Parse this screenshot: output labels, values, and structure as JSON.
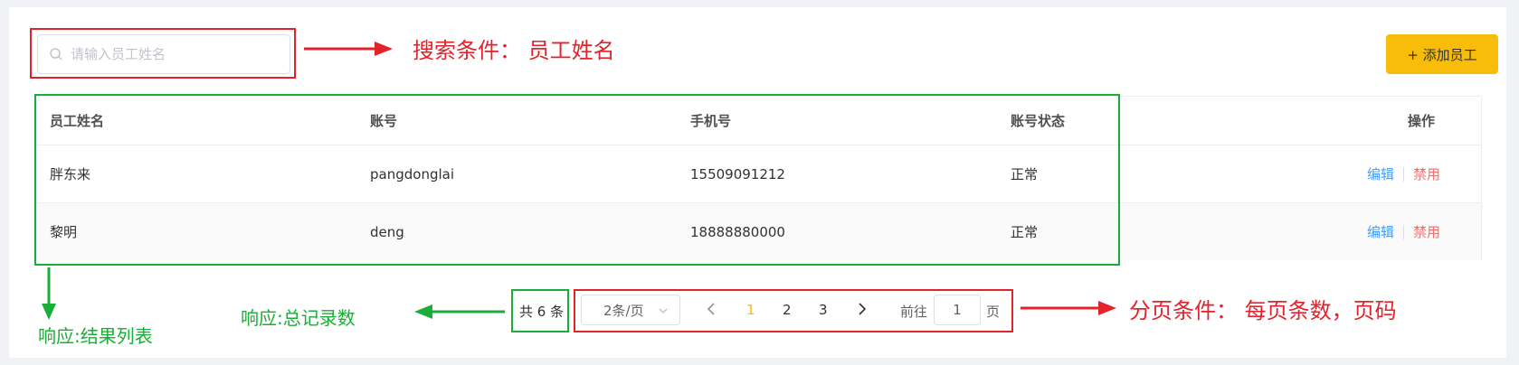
{
  "search": {
    "placeholder": "请输入员工姓名"
  },
  "toolbar": {
    "add_label": "+ 添加员工"
  },
  "annotations": {
    "search_condition": "搜索条件： 员工姓名",
    "result_list": "响应:结果列表",
    "total_records": "响应:总记录数",
    "page_condition": "分页条件： 每页条数，页码"
  },
  "table": {
    "columns": [
      "员工姓名",
      "账号",
      "手机号",
      "账号状态",
      "操作"
    ],
    "rows": [
      {
        "name": "胖东来",
        "account": "pangdonglai",
        "phone": "15509091212",
        "status": "正常",
        "edit": "编辑",
        "disable": "禁用"
      },
      {
        "name": "黎明",
        "account": "deng",
        "phone": "18888880000",
        "status": "正常",
        "edit": "编辑",
        "disable": "禁用"
      }
    ]
  },
  "pagination": {
    "total_label": "共 6 条",
    "page_size_label": "2条/页",
    "pages": [
      "1",
      "2",
      "3"
    ],
    "current_page": "1",
    "goto_prefix": "前往",
    "goto_value": "1",
    "goto_suffix": "页"
  },
  "colors": {
    "accent": "#f7bd0a",
    "link": "#409eff",
    "danger": "#f56c6c",
    "annotation_red": "#e3232c",
    "annotation_green": "#1aad37"
  }
}
